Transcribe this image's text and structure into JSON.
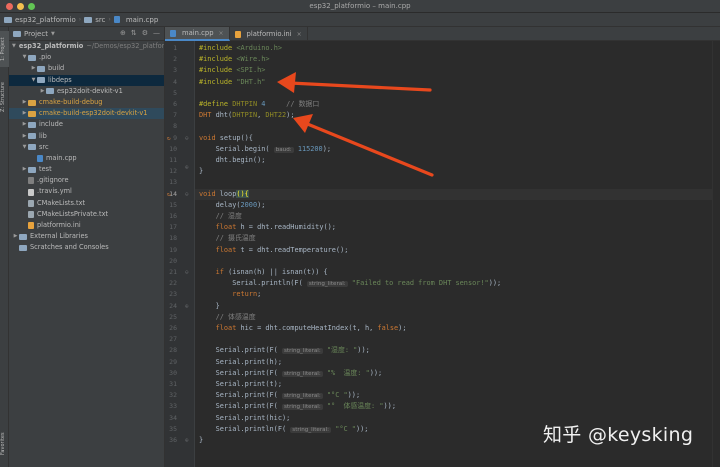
{
  "window": {
    "title": "esp32_platformio – main.cpp"
  },
  "breadcrumb": [
    "esp32_platformio",
    "src",
    "main.cpp"
  ],
  "project_panel": {
    "title": "Project",
    "tree": [
      {
        "label": "esp32_platformio",
        "path": "~/Demos/esp32_platformio",
        "type": "folder",
        "depth": 0,
        "open": true
      },
      {
        "label": ".pio",
        "type": "folder",
        "depth": 1,
        "open": true
      },
      {
        "label": "build",
        "type": "folder",
        "depth": 2,
        "open": false
      },
      {
        "label": "libdeps",
        "type": "folder",
        "depth": 2,
        "open": true,
        "selected": true
      },
      {
        "label": "esp32doit-devkit-v1",
        "type": "folder",
        "depth": 3,
        "open": false
      },
      {
        "label": "cmake-build-debug",
        "type": "folder-orange",
        "depth": 1,
        "open": false
      },
      {
        "label": "cmake-build-esp32doit-devkit-v1",
        "type": "folder-orange",
        "depth": 1,
        "open": false,
        "highlight": true
      },
      {
        "label": "include",
        "type": "folder",
        "depth": 1,
        "open": false
      },
      {
        "label": "lib",
        "type": "folder",
        "depth": 1,
        "open": false
      },
      {
        "label": "src",
        "type": "folder",
        "depth": 1,
        "open": true
      },
      {
        "label": "main.cpp",
        "type": "cpp",
        "depth": 2
      },
      {
        "label": "test",
        "type": "folder",
        "depth": 1,
        "open": false
      },
      {
        "label": ".gitignore",
        "type": "git",
        "depth": 1
      },
      {
        "label": ".travis.yml",
        "type": "yml",
        "depth": 1
      },
      {
        "label": "CMakeLists.txt",
        "type": "cmake",
        "depth": 1
      },
      {
        "label": "CMakeListsPrivate.txt",
        "type": "cmake",
        "depth": 1
      },
      {
        "label": "platformio.ini",
        "type": "pio",
        "depth": 1
      },
      {
        "label": "External Libraries",
        "type": "lib",
        "depth": 0,
        "open": false
      },
      {
        "label": "Scratches and Consoles",
        "type": "scratch",
        "depth": 0
      }
    ]
  },
  "side_tabs": {
    "project": "1: Project",
    "structure": "Z: Structure",
    "favorites": "Favorites"
  },
  "tabs": [
    {
      "label": "main.cpp",
      "active": true
    },
    {
      "label": "platformio.ini",
      "active": false
    }
  ],
  "code": {
    "lines": [
      {
        "n": "1",
        "html": "<span class='pp'>#include</span> <span class='str'>&lt;Arduino.h&gt;</span>"
      },
      {
        "n": "2",
        "html": "<span class='pp'>#include</span> <span class='str'>&lt;Wire.h&gt;</span>"
      },
      {
        "n": "3",
        "html": "<span class='pp'>#include</span> <span class='str'>&lt;SPI.h&gt;</span>"
      },
      {
        "n": "4",
        "html": "<span class='pp'>#include</span> <span class='str'>\"DHT.h\"</span>"
      },
      {
        "n": "5",
        "html": ""
      },
      {
        "n": "6",
        "html": "<span class='pp'>#define</span> <span class='mac'>DHTPIN</span> <span class='num'>4</span>     <span class='cmt'>// 数据口</span>"
      },
      {
        "n": "7",
        "html": "<span class='kw'>DHT</span> dht(<span class='mac'>DHTPIN</span>, <span class='mac'>DHT22</span>);"
      },
      {
        "n": "8",
        "html": ""
      },
      {
        "n": "9",
        "html": "<span class='kw'>void</span> setup(){"
      },
      {
        "n": "10",
        "html": "    Serial.begin( <span class='hint'>baud:</span> <span class='num'>115200</span>);"
      },
      {
        "n": "11",
        "html": "    dht.begin();"
      },
      {
        "n": "12",
        "html": "}"
      },
      {
        "n": "13",
        "html": ""
      },
      {
        "n": "14",
        "html": "<span class='kw'>void</span> loop<span class='bhl'>()</span><span class='bhl'>{</span>",
        "current": true
      },
      {
        "n": "15",
        "html": "    delay(<span class='num'>2000</span>);"
      },
      {
        "n": "16",
        "html": "    <span class='cmt'>// 湿度</span>"
      },
      {
        "n": "17",
        "html": "    <span class='kw'>float</span> h = dht.readHumidity();"
      },
      {
        "n": "18",
        "html": "    <span class='cmt'>// 摄氏温度</span>"
      },
      {
        "n": "19",
        "html": "    <span class='kw'>float</span> t = dht.readTemperature();"
      },
      {
        "n": "20",
        "html": ""
      },
      {
        "n": "21",
        "html": "    <span class='kw'>if</span> (isnan(h) || isnan(t)) {"
      },
      {
        "n": "22",
        "html": "        Serial.println(F( <span class='hint'>string_literal:</span> <span class='str'>\"Failed to read from DHT sensor!\"</span>));"
      },
      {
        "n": "23",
        "html": "        <span class='kw'>return</span>;"
      },
      {
        "n": "24",
        "html": "    }"
      },
      {
        "n": "25",
        "html": "    <span class='cmt'>// 体感温度</span>"
      },
      {
        "n": "26",
        "html": "    <span class='kw'>float</span> hic = dht.computeHeatIndex(t, h, <span class='kw'>false</span>);"
      },
      {
        "n": "27",
        "html": ""
      },
      {
        "n": "28",
        "html": "    Serial.print(F( <span class='hint'>string_literal:</span> <span class='str'>\"湿度: \"</span>));"
      },
      {
        "n": "29",
        "html": "    Serial.print(h);"
      },
      {
        "n": "30",
        "html": "    Serial.print(F( <span class='hint'>string_literal:</span> <span class='str'>\"%  温度: \"</span>));"
      },
      {
        "n": "31",
        "html": "    Serial.print(t);"
      },
      {
        "n": "32",
        "html": "    Serial.print(F( <span class='hint'>string_literal:</span> <span class='str'>\"°C \"</span>));"
      },
      {
        "n": "33",
        "html": "    Serial.print(F( <span class='hint'>string_literal:</span> <span class='str'>\"°  体感温度: \"</span>));"
      },
      {
        "n": "34",
        "html": "    Serial.print(hic);"
      },
      {
        "n": "35",
        "html": "    Serial.println(F( <span class='hint'>string_literal:</span> <span class='str'>\"°C \"</span>));"
      },
      {
        "n": "36",
        "html": "}"
      }
    ]
  },
  "watermark": "知乎 @keysking",
  "colors": {
    "annotation_arrow": "#e8481d",
    "editor_bg": "#2b2b2b",
    "panel_bg": "#3c3f41"
  }
}
